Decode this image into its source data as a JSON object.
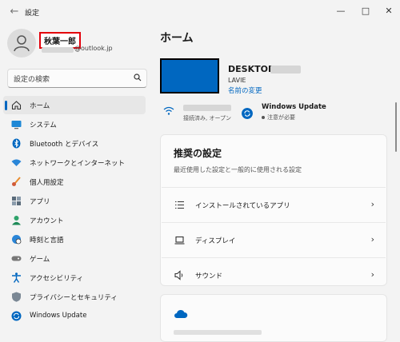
{
  "window": {
    "title": "設定",
    "back_icon": "arrow-left-icon",
    "controls": [
      "minimize-icon",
      "maximize-icon",
      "close-icon"
    ]
  },
  "account": {
    "name": "秋葉一郎",
    "email_suffix": "@outlook.jp"
  },
  "search": {
    "placeholder": "設定の検索"
  },
  "nav": [
    {
      "label": "ホーム",
      "icon": "home-icon",
      "selected": true
    },
    {
      "label": "システム",
      "icon": "monitor-icon"
    },
    {
      "label": "Bluetooth とデバイス",
      "icon": "bluetooth-icon"
    },
    {
      "label": "ネットワークとインターネット",
      "icon": "wifi-icon"
    },
    {
      "label": "個人用設定",
      "icon": "brush-icon"
    },
    {
      "label": "アプリ",
      "icon": "apps-icon"
    },
    {
      "label": "アカウント",
      "icon": "person-icon"
    },
    {
      "label": "時刻と言語",
      "icon": "globe-clock-icon"
    },
    {
      "label": "ゲーム",
      "icon": "gamepad-icon"
    },
    {
      "label": "アクセシビリティ",
      "icon": "accessibility-icon"
    },
    {
      "label": "プライバシーとセキュリティ",
      "icon": "shield-icon"
    },
    {
      "label": "Windows Update",
      "icon": "sync-icon"
    }
  ],
  "main": {
    "title": "ホーム",
    "device": {
      "name_prefix": "DESKTOP-",
      "model": "LAVIE",
      "rename_link": "名前の変更"
    },
    "network": {
      "status": "接続済み, オープン"
    },
    "update": {
      "title": "Windows Update",
      "status": "注意が必要"
    },
    "recommended": {
      "title": "推奨の設定",
      "subtitle": "最近使用した設定と一般的に使用される設定",
      "items": [
        {
          "label": "インストールされているアプリ",
          "icon": "list-icon"
        },
        {
          "label": "ディスプレイ",
          "icon": "laptop-icon"
        },
        {
          "label": "サウンド",
          "icon": "speaker-icon"
        }
      ]
    }
  },
  "colors": {
    "accent": "#0067c0",
    "highlight_border": "#e3000b",
    "background": "#f3f3f3"
  }
}
